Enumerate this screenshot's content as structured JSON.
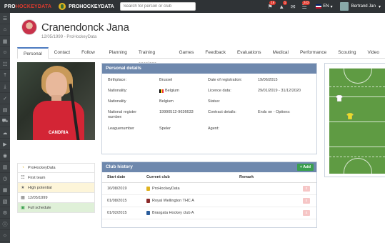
{
  "topbar": {
    "logo_pro": "PRO",
    "logo_hockey": "HOCKEYDATA",
    "club_name": "PROHOCKEYDATA",
    "search_placeholder": "Search for person or club",
    "badge_1": "16",
    "badge_2": "1",
    "badge_3": "243",
    "lang": "EN",
    "user_name": "Bertrand Jan"
  },
  "sidebar": {
    "icons": [
      "menu-icon",
      "home-icon",
      "calendar-icon",
      "person-icon",
      "users-icon",
      "upload-icon",
      "download-icon",
      "check-icon",
      "clipboard-icon",
      "cart-icon",
      "cloud-icon",
      "film-icon",
      "camera-icon",
      "chart-icon",
      "clock-icon",
      "grid-icon",
      "book-icon",
      "settings-icon",
      "info-icon",
      "bulb-icon"
    ]
  },
  "header": {
    "name": "Cranendonck Jana",
    "sub": "12/05/1999 - ProHockeyData"
  },
  "tabs": [
    "Personal",
    "Contact",
    "Follow up",
    "Planning",
    "Training sessions",
    "Games",
    "Feedback",
    "Evaluations",
    "Medical",
    "Performance",
    "Scouting",
    "Video"
  ],
  "photo": {
    "shirt_text": "CANDRIA"
  },
  "infolist": [
    {
      "label": "ProHockeyData",
      "style": ""
    },
    {
      "label": "First team",
      "style": ""
    },
    {
      "label": "High potential",
      "style": "yellow"
    },
    {
      "label": "12/05/1999",
      "style": ""
    },
    {
      "label": "Full schedule",
      "style": "green"
    }
  ],
  "personal": {
    "title": "Personal details",
    "birthplace_label": "Birthplace:",
    "birthplace": "Brussel",
    "nationality_label": "Nationality:",
    "nationality": "Belgium",
    "nationality2_label": "Nationality",
    "nationality2": "Belgium",
    "register_label": "National register number:",
    "register": "19990512-9636633",
    "league_label": "Leaguenumber",
    "league": "Speler",
    "reg_date_label": "Date of registration:",
    "reg_date": "19/06/2015",
    "licence_label": "Licence data:",
    "licence": "29/01/2019 - 31/12/2020",
    "status_label": "Status:",
    "contract_label": "Contract details:",
    "contract": "Ends on  -  Options:",
    "agent_label": "Agent:"
  },
  "club_history": {
    "title": "Club history",
    "add_label": "+ Add",
    "columns": [
      "Start date",
      "Current club",
      "Remark"
    ],
    "rows": [
      {
        "date": "16/08/2019",
        "club": "ProHockeyData"
      },
      {
        "date": "01/08/2015",
        "club": "Royal Wellington THC A"
      },
      {
        "date": "01/02/2015",
        "club": "Braxgata Hockey club A"
      }
    ],
    "delete_label": "x"
  },
  "field": {
    "color": "#5f9b43"
  }
}
